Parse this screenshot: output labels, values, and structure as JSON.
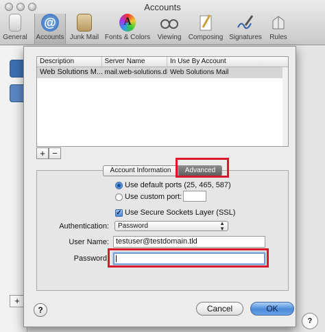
{
  "window": {
    "title": "Accounts"
  },
  "toolbar": {
    "items": [
      {
        "label": "General",
        "icon": "general-switch-icon"
      },
      {
        "label": "Accounts",
        "icon": "at-sign-icon",
        "selected": true
      },
      {
        "label": "Junk Mail",
        "icon": "junk-mail-icon"
      },
      {
        "label": "Fonts & Colors",
        "icon": "fonts-colors-icon"
      },
      {
        "label": "Viewing",
        "icon": "glasses-icon"
      },
      {
        "label": "Composing",
        "icon": "pencil-paper-icon"
      },
      {
        "label": "Signatures",
        "icon": "signature-pen-icon"
      },
      {
        "label": "Rules",
        "icon": "rules-icon"
      }
    ]
  },
  "background": {
    "plus": "+",
    "help": "?"
  },
  "sheet": {
    "table": {
      "headers": [
        "Description",
        "Server Name",
        "In Use By Account"
      ],
      "rows": [
        [
          "Web Solutions M...",
          "mail.web-solutions.dk",
          "Web Solutions Mail"
        ]
      ]
    },
    "add_label": "+",
    "remove_label": "−",
    "tabs": {
      "account_info": "Account Information",
      "advanced": "Advanced",
      "selected": "advanced"
    },
    "ports": {
      "default_label": "Use default ports (25, 465, 587)",
      "custom_label": "Use custom port:",
      "custom_value": "",
      "selected": "default"
    },
    "ssl": {
      "label": "Use Secure Sockets Layer (SSL)",
      "checked": true
    },
    "auth": {
      "label": "Authentication:",
      "value": "Password"
    },
    "username": {
      "label": "User Name:",
      "value": "testuser@testdomain.tld"
    },
    "password": {
      "label": "Password:",
      "value": ""
    },
    "buttons": {
      "help": "?",
      "cancel": "Cancel",
      "ok": "OK"
    }
  },
  "colors": {
    "highlight": "#d9192b",
    "accent": "#4a8ad9",
    "selection_row": "#d5d5d5"
  }
}
